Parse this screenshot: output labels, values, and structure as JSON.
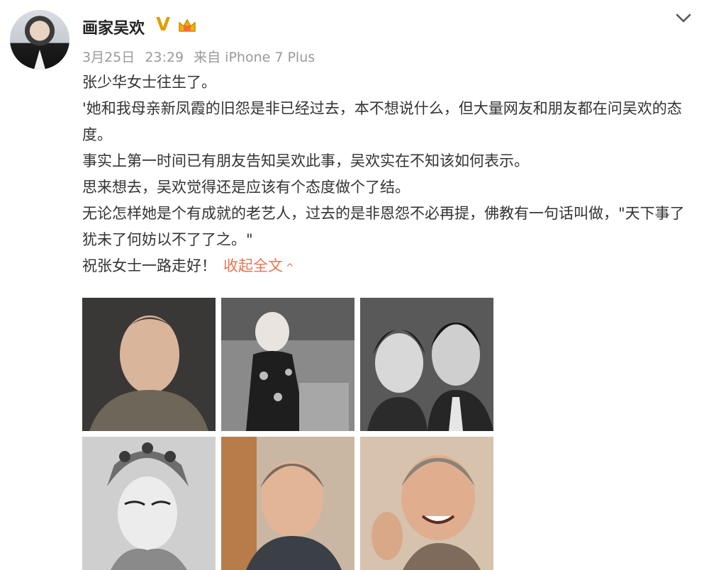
{
  "header": {
    "username": "画家吴欢",
    "vip_mark": "V",
    "badge_icon": "crown-badge-icon",
    "menu_icon": "chevron-down-icon"
  },
  "meta": {
    "date": "3月25日",
    "time": "23:29",
    "source": "来自 iPhone 7 Plus"
  },
  "post": {
    "lines": [
      "张少华女士往生了。",
      "'她和我母亲新凤霞的旧怨是非已经过去，本不想说什么，但大量网友和朋友都在问吴欢的态度。",
      "事实上第一时间已有朋友告知吴欢此事，吴欢实在不知该如何表示。",
      "思来想去，吴欢觉得还是应该有个态度做个了结。",
      "无论怎样她是个有成就的老艺人，过去的是非恩怨不必再提，佛教有一句话叫做，\"天下事了犹未了何妨以不了了之。\""
    ],
    "last_line": "祝张女士一路走好！",
    "collapse_label": "收起全文",
    "collapse_arrow": "^"
  },
  "colors": {
    "accent": "#eb7350",
    "vip": "#e0a000",
    "meta_text": "#9a9a9a"
  }
}
